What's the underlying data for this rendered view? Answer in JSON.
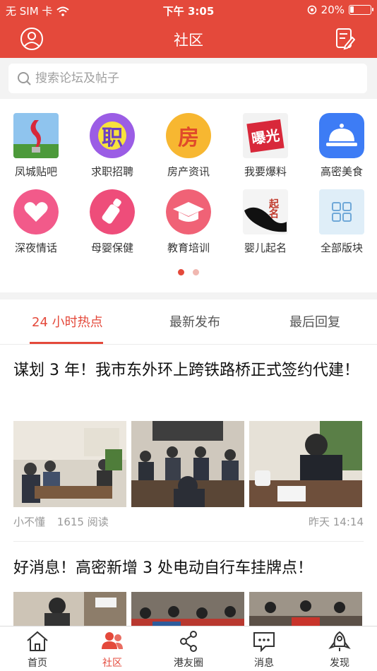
{
  "status_bar": {
    "carrier": "无 SIM 卡",
    "time": "下午 3:05",
    "battery": "20%"
  },
  "navbar": {
    "title": "社区",
    "left_icon": "user-circle-icon",
    "right_icon": "edit-note-icon"
  },
  "search": {
    "placeholder": "搜索论坛及帖子"
  },
  "categories": [
    {
      "label": "凤城贴吧",
      "icon": "monument-thumbnail"
    },
    {
      "label": "求职招聘",
      "icon": "job-icon",
      "glyph": "职",
      "color": "#9b5de5"
    },
    {
      "label": "房产资讯",
      "icon": "house-icon",
      "glyph": "房",
      "color": "#f7b731"
    },
    {
      "label": "我要爆料",
      "icon": "expose-thumbnail",
      "glyph": "曝光"
    },
    {
      "label": "高密美食",
      "icon": "food-cloche-icon",
      "color": "#3d7cf5"
    },
    {
      "label": "深夜情话",
      "icon": "heart-chat-icon",
      "color": "#f25a8a"
    },
    {
      "label": "母婴保健",
      "icon": "baby-bottle-icon",
      "color": "#ee4d7a"
    },
    {
      "label": "教育培训",
      "icon": "graduation-cap-icon",
      "color": "#f06276"
    },
    {
      "label": "婴儿起名",
      "icon": "calligraphy-thumbnail",
      "glyph": "起名"
    },
    {
      "label": "全部版块",
      "icon": "grid-icon",
      "color": "#dfeef8"
    }
  ],
  "tabs": [
    {
      "label": "24 小时热点",
      "active": true
    },
    {
      "label": "最新发布",
      "active": false
    },
    {
      "label": "最后回复",
      "active": false
    }
  ],
  "posts": [
    {
      "title": "谋划 3 年！我市东外环上跨铁路桥正式签约代建！",
      "author": "小不懂",
      "reads": "1615 阅读",
      "time": "昨天  14:14"
    },
    {
      "title": "好消息！高密新增 3 处电动自行车挂牌点！"
    }
  ],
  "tabbar": [
    {
      "label": "首页",
      "icon": "home-icon",
      "active": false
    },
    {
      "label": "社区",
      "icon": "community-icon",
      "active": true
    },
    {
      "label": "港友圈",
      "icon": "share-circle-icon",
      "active": false
    },
    {
      "label": "消息",
      "icon": "message-icon",
      "active": false
    },
    {
      "label": "发现",
      "icon": "rocket-icon",
      "active": false
    }
  ],
  "colors": {
    "brand": "#e4493b",
    "background": "#f3f3f3"
  }
}
